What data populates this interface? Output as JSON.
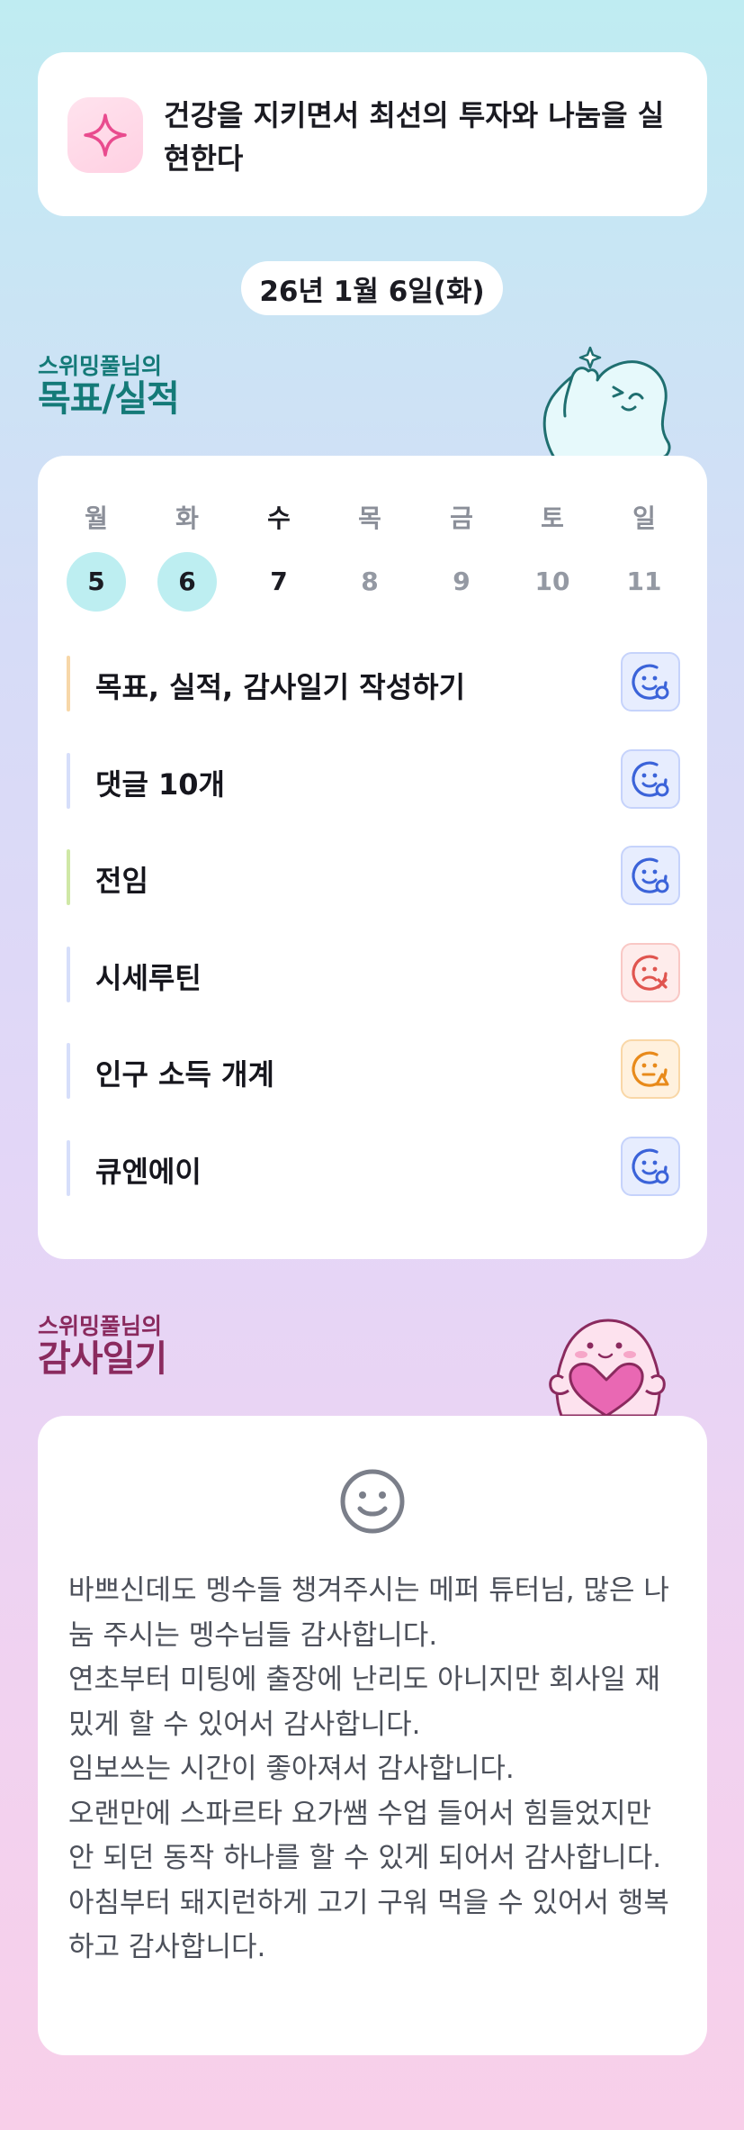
{
  "goal": {
    "text": "건강을 지키면서 최선의 투자와 나눔을 실현한다",
    "icon": "sparkle-icon",
    "accent": "#e94b8e"
  },
  "date_label": "26년 1월 6일(화)",
  "goals_section": {
    "subtitle": "스위밍풀님의",
    "title": "목표/실적",
    "color": "#147a78"
  },
  "week": {
    "days": [
      {
        "name": "월",
        "num": "5",
        "state": "done"
      },
      {
        "name": "화",
        "num": "6",
        "state": "done"
      },
      {
        "name": "수",
        "num": "7",
        "state": "today"
      },
      {
        "name": "목",
        "num": "8",
        "state": "future"
      },
      {
        "name": "금",
        "num": "9",
        "state": "future"
      },
      {
        "name": "토",
        "num": "10",
        "state": "future"
      },
      {
        "name": "일",
        "num": "11",
        "state": "future"
      }
    ],
    "done_color": "#bdeef1"
  },
  "tasks": [
    {
      "label": "목표, 실적, 감사일기 작성하기",
      "bar_color": "#f7d7a8",
      "status": "complete",
      "icon": "smile-check-icon"
    },
    {
      "label": "댓글 10개",
      "bar_color": "#d6defa",
      "status": "complete",
      "icon": "smile-check-icon"
    },
    {
      "label": "전임",
      "bar_color": "#cfe8a6",
      "status": "complete",
      "icon": "smile-check-icon"
    },
    {
      "label": "시세루틴",
      "bar_color": "#d6defa",
      "status": "failed",
      "icon": "frown-x-icon"
    },
    {
      "label": "인구 소득 개계",
      "bar_color": "#d6defa",
      "status": "partial",
      "icon": "meh-triangle-icon"
    },
    {
      "label": "큐엔에이",
      "bar_color": "#d6defa",
      "status": "complete",
      "icon": "smile-check-icon"
    }
  ],
  "gratitude_section": {
    "subtitle": "스위밍풀님의",
    "title": "감사일기",
    "color": "#8a2a5e"
  },
  "gratitude": {
    "icon": "smile-icon",
    "text": "바쁘신데도 멩수들 챙겨주시는 메퍼 튜터님, 많은 나눔 주시는 멩수님들 감사합니다.\n연초부터 미팅에 출장에 난리도 아니지만 회사일 재밌게 할 수 있어서 감사합니다.\n임보쓰는 시간이 좋아져서 감사합니다.\n오랜만에 스파르타 요가쌤 수업 들어서 힘들었지만 안 되던 동작 하나를 할 수 있게 되어서 감사합니다.\n아침부터 돼지런하게 고기 구워 먹을 수 있어서 행복하고 감사합니다."
  }
}
